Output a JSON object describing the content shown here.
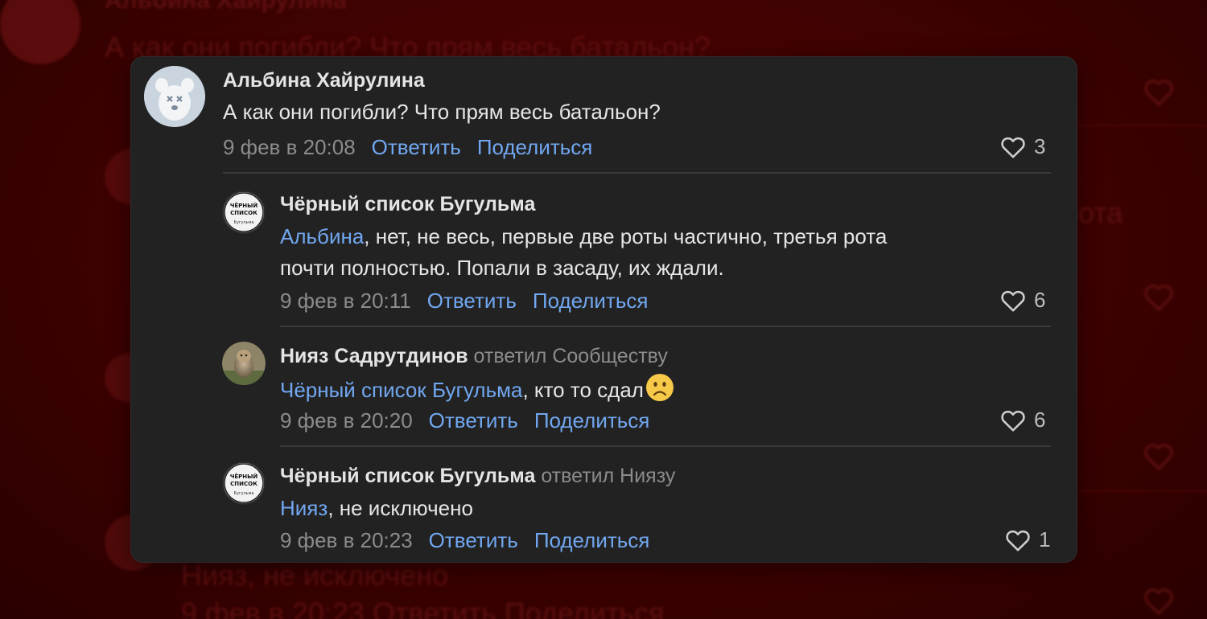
{
  "background": {
    "author": "Альбина Хайрулина",
    "text": "А как они погибли? Что прям весь батальон?",
    "fragment_right": "ота",
    "reply_text": "Нияз, не исключено",
    "reply_meta": "9 фев в 20:23   Ответить   Поделиться"
  },
  "colors": {
    "card_bg": "#222222",
    "link": "#71a7f0",
    "muted": "#8c8c8c",
    "backdrop": "#420202"
  },
  "comments": [
    {
      "author": "Альбина Хайрулина",
      "replied_to": "",
      "mention": "",
      "text_line1": "А как они погибли? Что прям весь батальон?",
      "text_line2": "",
      "date": "9 фев в 20:08",
      "reply_label": "Ответить",
      "share_label": "Поделиться",
      "likes": "3",
      "avatar": "dog-avatar-icon"
    },
    {
      "author": "Чёрный список Бугульма",
      "replied_to": "",
      "mention": "Альбина",
      "text_line1": ", нет, не весь, первые две роты частично, третья рота",
      "text_line2": "почти полностью. Попали в засаду, их ждали.",
      "date": "9 фев в 20:11",
      "reply_label": "Ответить",
      "share_label": "Поделиться",
      "likes": "6",
      "avatar": "black-list-logo-icon",
      "avatar_text": [
        "ЧЁРНЫЙ",
        "СПИСОК",
        "Бугульма"
      ]
    },
    {
      "author": "Нияз Садрутдинов",
      "replied_to": "ответил Сообществу",
      "mention": "Чёрный список Бугульма",
      "text_line1": ", кто то сдал",
      "emoji": "🙁",
      "date": "9 фев в 20:20",
      "reply_label": "Ответить",
      "share_label": "Поделиться",
      "likes": "6",
      "avatar": "dog-photo-avatar"
    },
    {
      "author": "Чёрный список Бугульма",
      "replied_to": "ответил Ниязу",
      "mention": "Нияз",
      "text_line1": ", не исключено",
      "date": "9 фев в 20:23",
      "reply_label": "Ответить",
      "share_label": "Поделиться",
      "likes": "1",
      "avatar": "black-list-logo-icon",
      "avatar_text": [
        "ЧЁРНЫЙ",
        "СПИСОК",
        "Бугульма"
      ]
    }
  ]
}
